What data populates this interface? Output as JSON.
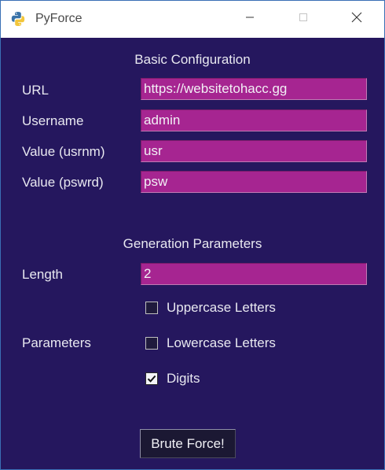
{
  "window": {
    "title": "PyForce",
    "app_icon": "python-icon",
    "controls": [
      "minimize-icon",
      "maximize-icon",
      "close-icon"
    ]
  },
  "basic": {
    "heading": "Basic Configuration",
    "url_label": "URL",
    "url_value": "https://websitetohacc.gg",
    "username_label": "Username",
    "username_value": "admin",
    "usrnm_label": "Value (usrnm)",
    "usrnm_value": "usr",
    "pswrd_label": "Value (pswrd)",
    "pswrd_value": "psw"
  },
  "generation": {
    "heading": "Generation Parameters",
    "length_label": "Length",
    "length_value": "2",
    "parameters_label": "Parameters",
    "options": [
      {
        "label": "Uppercase Letters",
        "checked": false
      },
      {
        "label": "Lowercase Letters",
        "checked": false
      },
      {
        "label": "Digits",
        "checked": true
      }
    ]
  },
  "action": {
    "button_label": "Brute Force!"
  },
  "colors": {
    "background": "#25175e",
    "field": "#a62591",
    "text": "#e8e8f0"
  }
}
